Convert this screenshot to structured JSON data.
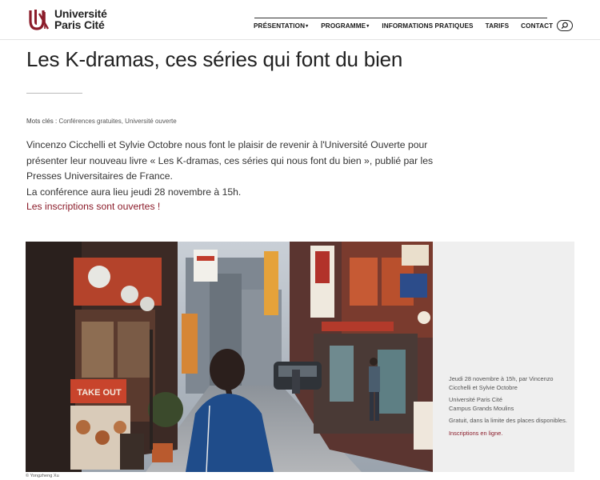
{
  "header": {
    "logo_line1": "Université",
    "logo_line2": "Paris Cité",
    "nav": [
      {
        "label": "PRÉSENTATION",
        "has_caret": true
      },
      {
        "label": "PROGRAMME",
        "has_caret": true
      },
      {
        "label": "INFORMATIONS PRATIQUES",
        "has_caret": false
      },
      {
        "label": "TARIFS",
        "has_caret": false
      },
      {
        "label": "CONTACT",
        "has_caret": false
      }
    ]
  },
  "article": {
    "title": "Les K-dramas, ces séries qui font du bien",
    "keywords_label": "Mots clés :",
    "keywords": "Conférences gratuites, Université ouverte",
    "paragraph": "Vincenzo Cicchelli et Sylvie Octobre nous font le plaisir de revenir à l'Université Ouverte pour présenter leur nouveau livre « Les K-dramas, ces séries qui nous font du bien », publié par les Presses Universitaires de France.",
    "paragraph2": "La conférence aura lieu jeudi 28 novembre à 15h.",
    "inscriptions": "Les inscriptions sont ouvertes !"
  },
  "aside": {
    "when": "Jeudi 28 novembre à 15h, par Vincenzo Cicchelli et Sylvie Octobre",
    "place_line1": "Université Paris Cité",
    "place_line2": "Campus Grands Moulins",
    "price": "Gratuit, dans la limite des places disponibles.",
    "link": "Inscriptions en ligne."
  },
  "photo": {
    "credit": "© Yongzheng Xu",
    "sign_text": "TAKE OUT"
  },
  "colors": {
    "brand": "#8b1c2a",
    "aside_bg": "#efefef"
  }
}
